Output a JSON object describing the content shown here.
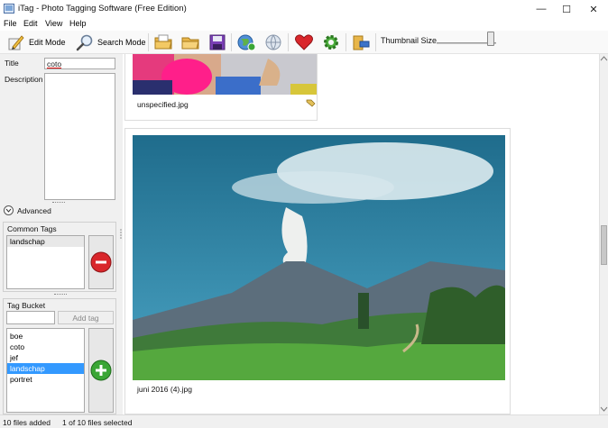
{
  "window": {
    "title": "iTag - Photo Tagging Software (Free Edition)",
    "minimize_glyph": "—",
    "maximize_glyph": "☐",
    "close_glyph": "✕"
  },
  "menu": [
    "File",
    "Edit",
    "View",
    "Help"
  ],
  "toolbar": {
    "edit_mode_label": "Edit Mode",
    "search_mode_label": "Search Mode",
    "thumbnail_size_label": "Thumbnail Size",
    "thumbnail_size_level": 0.9,
    "icons": [
      "edit-pencil-icon",
      "search-magnifier-icon",
      "open-file-icon",
      "open-folder-icon",
      "save-disk-icon",
      "globe-icon",
      "network-globe-icon",
      "favorite-heart-icon",
      "settings-gear-icon",
      "export-tool-icon"
    ]
  },
  "left_panel": {
    "title_label": "Title",
    "title_value": "coto",
    "description_label": "Description",
    "description_value": "",
    "advanced_label": "Advanced",
    "common_tags_label": "Common Tags",
    "common_tags": [
      "landschap"
    ],
    "tag_bucket_label": "Tag Bucket",
    "tag_input_value": "",
    "add_tag_label": "Add tag",
    "bucket_tags": [
      "boe",
      "coto",
      "jef",
      "landschap",
      "portret"
    ],
    "selected_bucket_tag": "landschap"
  },
  "content": {
    "thumbnails": [
      {
        "filename": "unspecified.jpg"
      },
      {
        "filename": "juni 2016 (4).jpg"
      }
    ]
  },
  "status": {
    "files_added": "10 files added",
    "selection": "1 of 10 files selected"
  },
  "colors": {
    "selection": "#3399ff",
    "remove_button": "#d9262b",
    "add_button": "#3aa635"
  }
}
